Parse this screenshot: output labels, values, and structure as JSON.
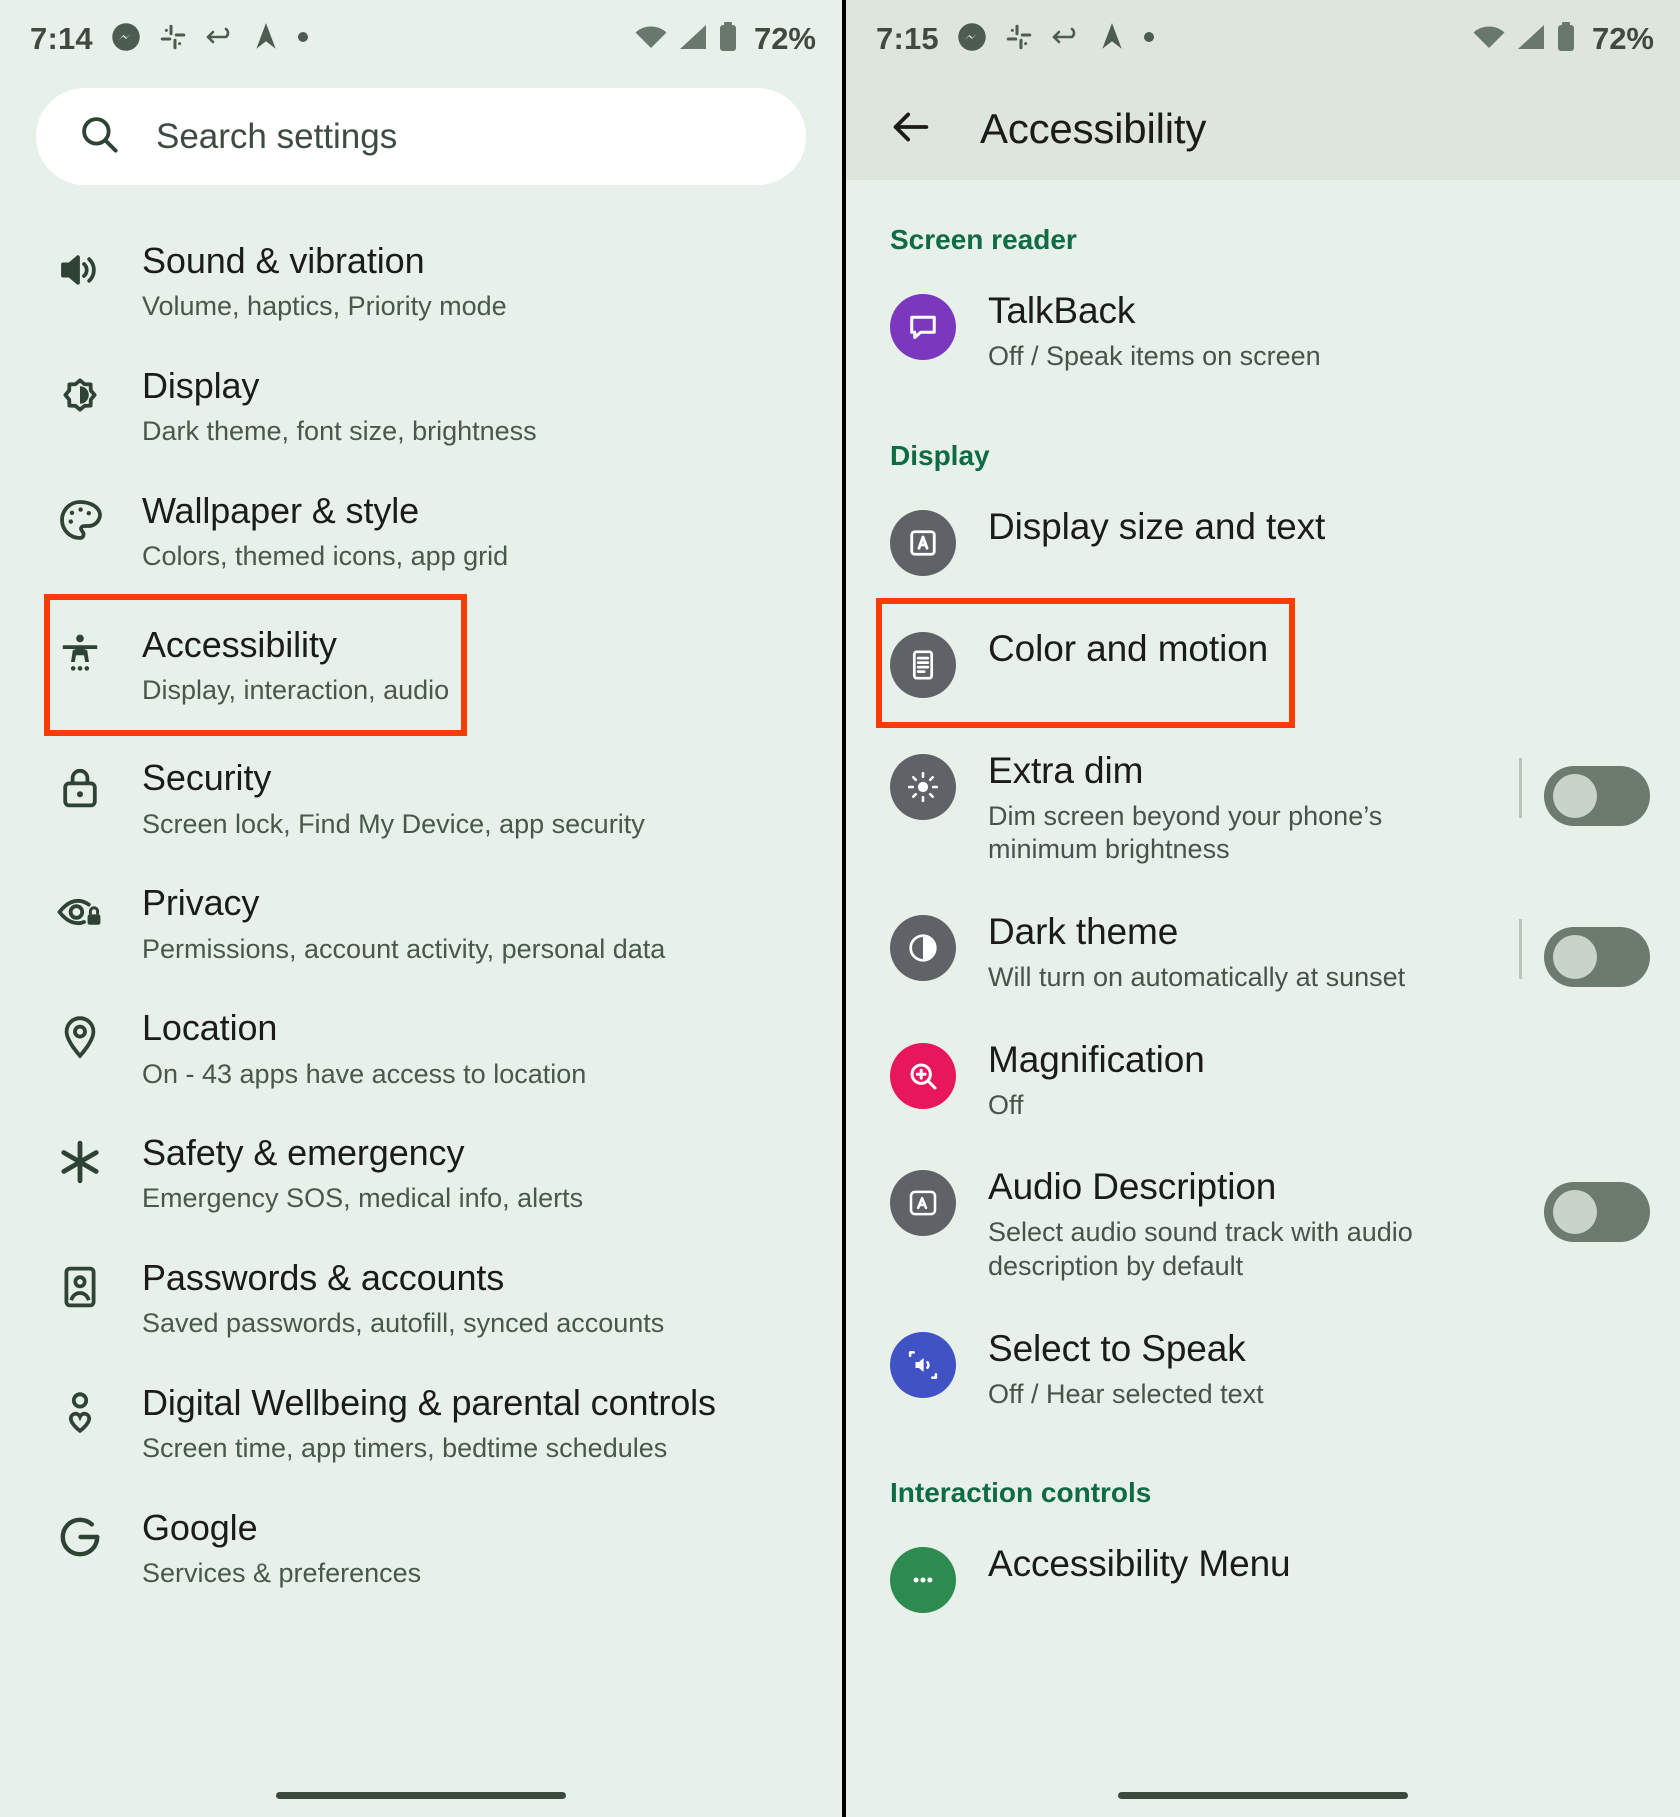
{
  "left": {
    "status": {
      "time": "7:14",
      "battery_pct": "72%",
      "icons": [
        "messenger-icon",
        "slack-icon",
        "arrow-loop-icon",
        "navigation-icon",
        "dot-icon"
      ],
      "right_icons": [
        "wifi-icon",
        "signal-icon",
        "battery-icon"
      ]
    },
    "search": {
      "placeholder": "Search settings",
      "icon": "search-icon"
    },
    "items": [
      {
        "icon": "sound-icon",
        "title": "Sound & vibration",
        "subtitle": "Volume, haptics, Priority mode"
      },
      {
        "icon": "display-icon",
        "title": "Display",
        "subtitle": "Dark theme, font size, brightness"
      },
      {
        "icon": "palette-icon",
        "title": "Wallpaper & style",
        "subtitle": "Colors, themed icons, app grid"
      },
      {
        "icon": "accessibility-icon",
        "title": "Accessibility",
        "subtitle": "Display, interaction, audio",
        "highlighted": true
      },
      {
        "icon": "lock-icon",
        "title": "Security",
        "subtitle": "Screen lock, Find My Device, app security"
      },
      {
        "icon": "eye-lock-icon",
        "title": "Privacy",
        "subtitle": "Permissions, account activity, personal data"
      },
      {
        "icon": "location-pin-icon",
        "title": "Location",
        "subtitle": "On - 43 apps have access to location"
      },
      {
        "icon": "emergency-icon",
        "title": "Safety & emergency",
        "subtitle": "Emergency SOS, medical info, alerts"
      },
      {
        "icon": "account-card-icon",
        "title": "Passwords & accounts",
        "subtitle": "Saved passwords, autofill, synced accounts"
      },
      {
        "icon": "wellbeing-icon",
        "title": "Digital Wellbeing & parental controls",
        "subtitle": "Screen time, app timers, bedtime schedules"
      },
      {
        "icon": "google-g-icon",
        "title": "Google",
        "subtitle": "Services & preferences"
      }
    ]
  },
  "right": {
    "status": {
      "time": "7:15",
      "battery_pct": "72%"
    },
    "appbar": {
      "back_icon": "back-arrow-icon",
      "title": "Accessibility"
    },
    "sections": [
      {
        "header": "Screen reader",
        "items": [
          {
            "icon": "talkback-icon",
            "icon_bg": "#7b38bd",
            "title": "TalkBack",
            "subtitle": "Off / Speak items on screen",
            "toggle": null
          }
        ]
      },
      {
        "header": "Display",
        "items": [
          {
            "icon": "display-size-icon",
            "icon_bg": "#5f6368",
            "title": "Display size and text",
            "subtitle": "",
            "toggle": null
          },
          {
            "icon": "color-motion-icon",
            "icon_bg": "#5f6368",
            "title": "Color and motion",
            "subtitle": "",
            "toggle": null,
            "highlighted": true
          },
          {
            "icon": "extra-dim-icon",
            "icon_bg": "#5f6368",
            "title": "Extra dim",
            "subtitle": "Dim screen beyond your phone’s minimum brightness",
            "toggle": "off"
          },
          {
            "icon": "dark-theme-icon",
            "icon_bg": "#5f6368",
            "title": "Dark theme",
            "subtitle": "Will turn on automatically at sunset",
            "toggle": "off"
          },
          {
            "icon": "magnification-icon",
            "icon_bg": "#e8175d",
            "title": "Magnification",
            "subtitle": "Off",
            "toggle": null
          },
          {
            "icon": "audio-description-icon",
            "icon_bg": "#5f6368",
            "title": "Audio Description",
            "subtitle": "Select audio sound track with audio description by default",
            "toggle": "off"
          },
          {
            "icon": "select-to-speak-icon",
            "icon_bg": "#4152c4",
            "title": "Select to Speak",
            "subtitle": "Off / Hear selected text",
            "toggle": null
          }
        ]
      },
      {
        "header": "Interaction controls",
        "items": [
          {
            "icon": "accessibility-menu-icon",
            "icon_bg": "#2e8b4f",
            "title": "Accessibility Menu",
            "subtitle": "",
            "toggle": null
          }
        ]
      }
    ]
  },
  "colors": {
    "background": "#e7f0e9",
    "appbar": "#dde5dd",
    "highlight": "#fa3c00",
    "section_header": "#0f6b42",
    "title_text": "#1b1c18",
    "subtitle_text": "#46544a"
  }
}
